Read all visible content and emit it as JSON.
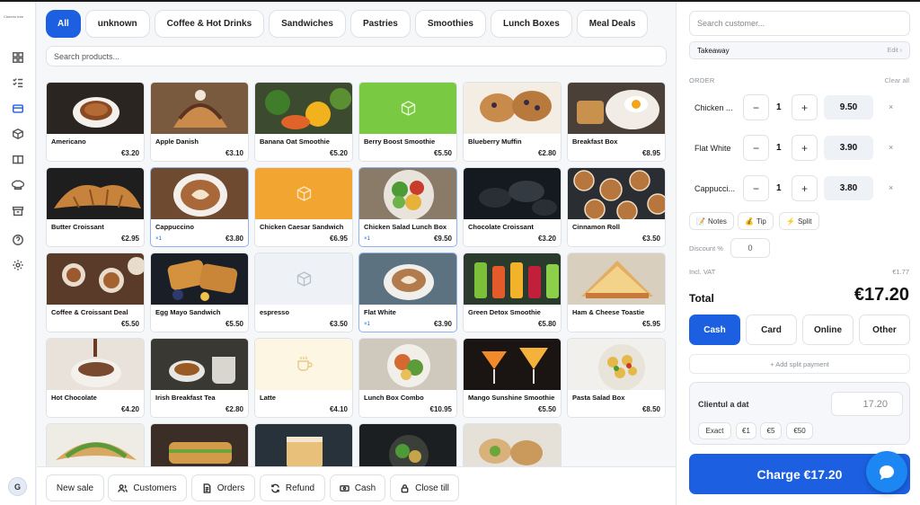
{
  "sidebar": {
    "logo": "Cheerio tree",
    "icons": [
      "dashboard-icon",
      "checklist-icon",
      "pos-card-icon",
      "box-icon",
      "book-icon",
      "chef-hat-icon",
      "archive-icon",
      "help-icon",
      "settings-icon"
    ],
    "active": "pos-card-icon",
    "avatar": "G"
  },
  "categories": [
    "All",
    "unknown",
    "Coffee & Hot Drinks",
    "Sandwiches",
    "Pastries",
    "Smoothies",
    "Lunch Boxes",
    "Meal Deals"
  ],
  "active_category": "All",
  "search_products": {
    "placeholder": "Search products..."
  },
  "products": [
    {
      "name": "Americano",
      "price": "€3.20",
      "thumb": "coffee-dark"
    },
    {
      "name": "Apple Danish",
      "price": "€3.10",
      "thumb": "pastry"
    },
    {
      "name": "Banana Oat Smoothie",
      "price": "€5.20",
      "thumb": "veg"
    },
    {
      "name": "Berry Boost Smoothie",
      "price": "€5.50",
      "thumb": "green-placeholder"
    },
    {
      "name": "Blueberry Muffin",
      "price": "€2.80",
      "thumb": "muffin"
    },
    {
      "name": "Breakfast Box",
      "price": "€8.95",
      "thumb": "breakfast"
    },
    {
      "name": "Butter Croissant",
      "price": "€2.95",
      "thumb": "croissant"
    },
    {
      "name": "Cappuccino",
      "price": "€3.80",
      "qty": "×1",
      "selected": true,
      "thumb": "latte"
    },
    {
      "name": "Chicken Caesar Sandwich",
      "price": "€6.95",
      "thumb": "orange-placeholder"
    },
    {
      "name": "Chicken Salad Lunch Box",
      "price": "€9.50",
      "qty": "×1",
      "selected": true,
      "thumb": "salad-bowl"
    },
    {
      "name": "Chocolate Croissant",
      "price": "€3.20",
      "thumb": "dark-pastry"
    },
    {
      "name": "Cinnamon Roll",
      "price": "€3.50",
      "thumb": "rolls"
    },
    {
      "name": "Coffee & Croissant Deal",
      "price": "€5.50",
      "thumb": "cups"
    },
    {
      "name": "Egg Mayo Sandwich",
      "price": "€5.50",
      "thumb": "toast"
    },
    {
      "name": "espresso",
      "price": "€3.50",
      "thumb": "grey-placeholder"
    },
    {
      "name": "Flat White",
      "price": "€3.90",
      "qty": "×1",
      "selected": true,
      "thumb": "latte2"
    },
    {
      "name": "Green Detox Smoothie",
      "price": "€5.80",
      "thumb": "juices"
    },
    {
      "name": "Ham & Cheese Toastie",
      "price": "€5.95",
      "thumb": "sandwich"
    },
    {
      "name": "Hot Chocolate",
      "price": "€4.20",
      "thumb": "cocoa"
    },
    {
      "name": "Irish Breakfast Tea",
      "price": "€2.80",
      "thumb": "tea"
    },
    {
      "name": "Latte",
      "price": "€4.10",
      "thumb": "cream-placeholder"
    },
    {
      "name": "Lunch Box Combo",
      "price": "€10.95",
      "thumb": "lunch"
    },
    {
      "name": "Mango Sunshine Smoothie",
      "price": "€5.50",
      "thumb": "cocktail"
    },
    {
      "name": "Pasta Salad Box",
      "price": "€8.50",
      "thumb": "pasta"
    },
    {
      "name": "",
      "price": "",
      "thumb": "wrap"
    },
    {
      "name": "",
      "price": "",
      "thumb": "sandwich2"
    },
    {
      "name": "",
      "price": "",
      "thumb": "cake"
    },
    {
      "name": "",
      "price": "",
      "thumb": "salad-dark"
    },
    {
      "name": "",
      "price": "",
      "thumb": "wraps2"
    }
  ],
  "bottom_bar": [
    {
      "label": "New sale",
      "icon": ""
    },
    {
      "label": "Customers",
      "icon": "users-icon"
    },
    {
      "label": "Orders",
      "icon": "document-icon"
    },
    {
      "label": "Refund",
      "icon": "refresh-icon"
    },
    {
      "label": "Cash",
      "icon": "cash-icon"
    },
    {
      "label": "Close till",
      "icon": "lock-icon"
    }
  ],
  "panel": {
    "search_customer": "Search customer...",
    "order_type": "Takeaway",
    "edit": "Edit ›",
    "order_header": "ORDER",
    "clear_all": "Clear all",
    "lines": [
      {
        "name": "Chicken Salad Lunch Box",
        "short": "Chicken ...",
        "qty": "1",
        "price": "9.50"
      },
      {
        "name": "Flat White",
        "short": "Flat White",
        "qty": "1",
        "price": "3.90"
      },
      {
        "name": "Cappuccino",
        "short": "Cappucci...",
        "qty": "1",
        "price": "3.80"
      }
    ],
    "chips": [
      "Notes",
      "Tip",
      "Split"
    ],
    "discount_label": "Discount %",
    "discount_value": "0",
    "vat_label": "Incl. VAT",
    "vat_value": "€1.77",
    "total_label": "Total",
    "total_value": "€17.20",
    "payment_methods": [
      "Cash",
      "Card",
      "Online",
      "Other"
    ],
    "active_payment": "Cash",
    "add_split": "+ Add split payment",
    "received_label": "Clientul a dat",
    "received_value": "17.20",
    "quick_cash": [
      "Exact",
      "€1",
      "€5",
      "€50"
    ],
    "charge": "Charge €17.20"
  },
  "colors": {
    "accent": "#1c5fe0",
    "chat": "#1c86f2"
  }
}
